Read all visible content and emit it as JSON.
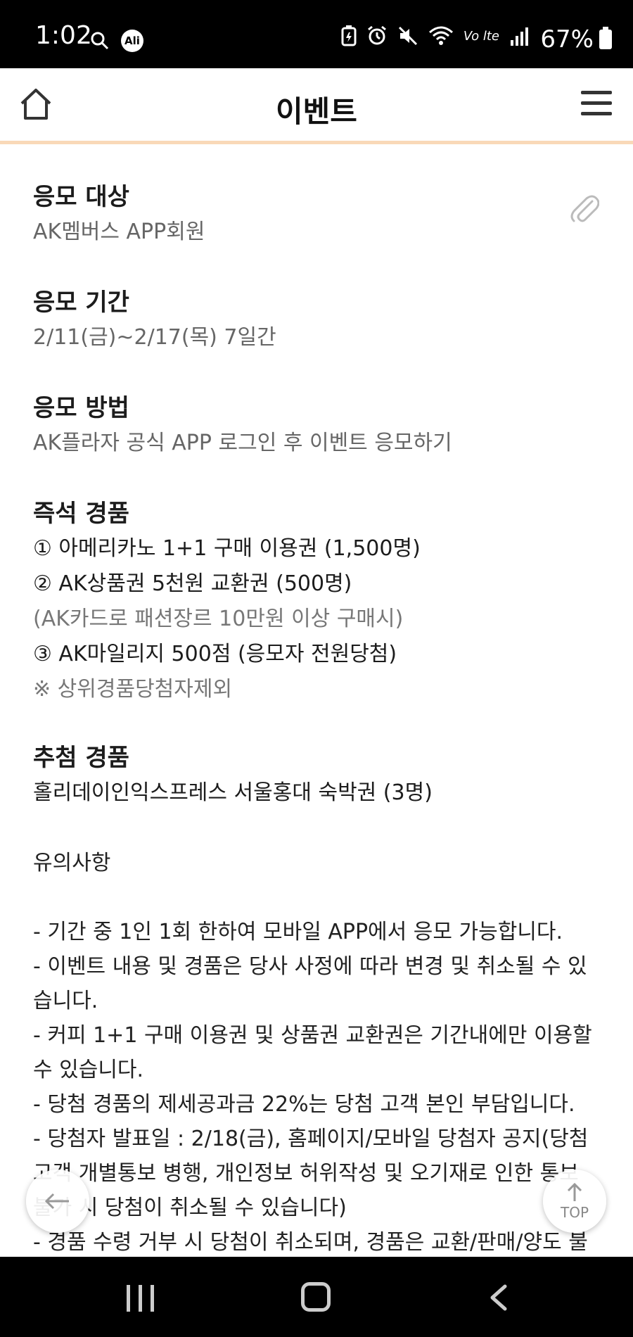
{
  "status_bar": {
    "time": "1:02",
    "ali_label": "Ali",
    "lte_label": "Vo lte",
    "battery_percent": "67%"
  },
  "header": {
    "title": "이벤트"
  },
  "sections": {
    "target": {
      "title": "응모 대상",
      "value": "AK멤버스 APP회원"
    },
    "period": {
      "title": "응모 기간",
      "value": "2/11(금)~2/17(목) 7일간"
    },
    "method": {
      "title": "응모 방법",
      "value": "AK플라자 공식 APP 로그인 후 이벤트 응모하기"
    },
    "attendance": {
      "title": "즉석 경품",
      "prize1": "① 아메리카노 1+1 구매 이용권 (1,500명)",
      "prize2": "② AK상품권 5천원 교환권 (500명)",
      "prize2_note": "(AK카드로 패션장르 10만원 이상 구매시)",
      "prize3": "③ AK마일리지 500점 (응모자 전원당첨)",
      "prize3_note": "※ 상위경품당첨자제외"
    },
    "lottery": {
      "title": "추첨 경품",
      "value": "홀리데이인익스프레스 서울홍대 숙박권 (3명)"
    },
    "notice": {
      "title": "유의사항",
      "lines": [
        "- 기간 중 1인 1회 한하여 모바일 APP에서 응모 가능합니다.",
        "- 이벤트 내용 및 경품은 당사 사정에 따라 변경 및 취소될 수 있",
        "습니다.",
        "- 커피 1+1 구매 이용권 및 상품권 교환권은 기간내에만 이용할",
        "수 있습니다.",
        "- 당첨 경품의 제세공과금 22%는 당첨 고객 본인 부담입니다.",
        "- 당첨자 발표일 : 2/18(금), 홈페이지/모바일 당첨자 공지(당첨",
        "고객 개별통보 병행, 개인정보 허위작성 및 오기재로 인한 통보",
        "불가 시 당첨이 취소될 수 있습니다)",
        "- 경품 수령 거부 시 당첨이 취소되며, 경품은 교환/판매/양도 불"
      ]
    }
  },
  "fab": {
    "top_label": "TOP"
  }
}
